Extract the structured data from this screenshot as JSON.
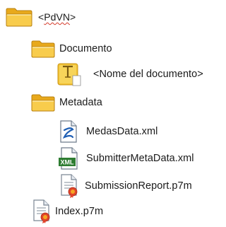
{
  "tree": {
    "root": {
      "label_prefix": "<",
      "label_core": "PdVN",
      "label_suffix": ">",
      "icon": "folder-icon"
    },
    "documento": {
      "label": "Documento",
      "icon": "folder-icon"
    },
    "nome_documento": {
      "label": "<Nome del documento>",
      "icon": "document-placeholder-icon"
    },
    "metadata": {
      "label": "Metadata",
      "icon": "folder-icon"
    },
    "files": [
      {
        "label": "MedasData.xml",
        "icon": "xml-schema-file-icon"
      },
      {
        "label": "SubmitterMetaData.xml",
        "icon": "xml-file-icon"
      },
      {
        "label": "SubmissionReport.p7m",
        "icon": "signed-document-icon"
      }
    ],
    "index": {
      "label": "Index.p7m",
      "icon": "signed-document-icon"
    }
  },
  "colors": {
    "folder_body": "#f6c343",
    "folder_front": "#fde18a",
    "folder_edge": "#c9951a",
    "doc_placeholder": "#f2c233",
    "xml_green": "#2e7d32",
    "signature_red": "#e0442a",
    "spellcheck_red": "#d43a2a"
  }
}
